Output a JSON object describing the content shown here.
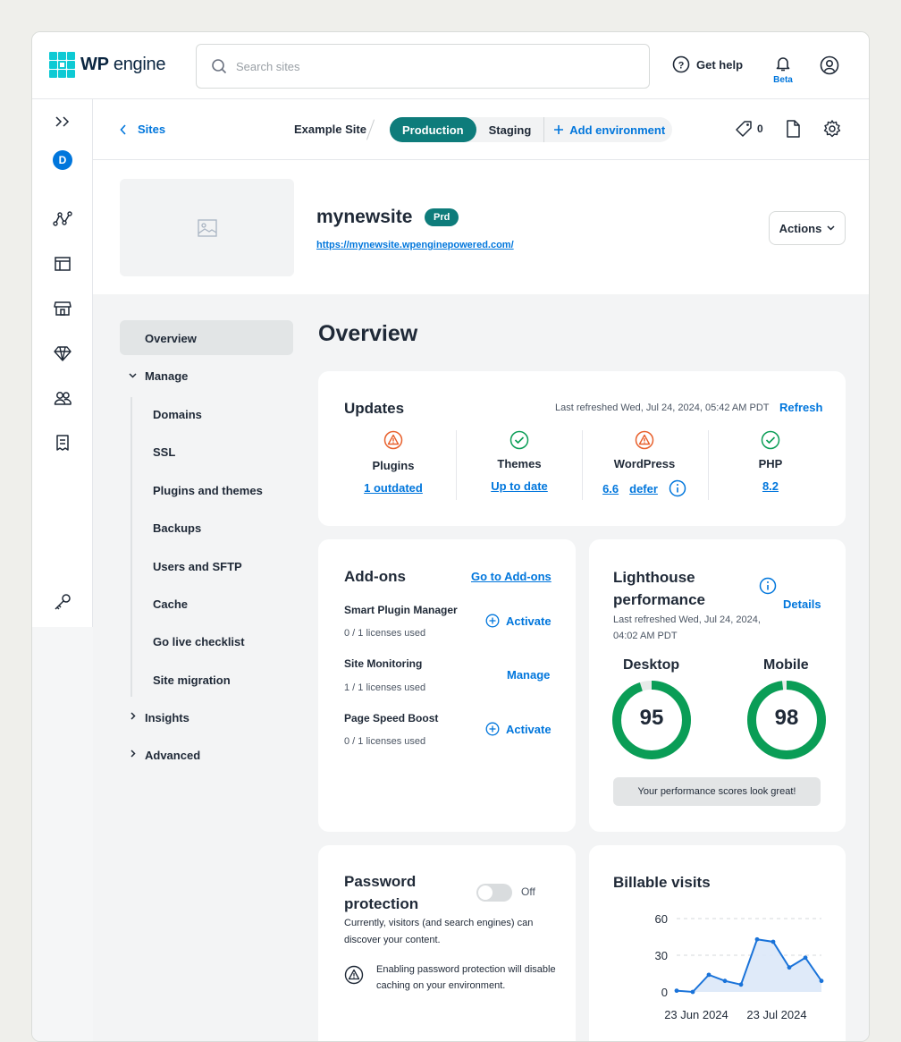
{
  "topbar": {
    "logo_text_bold": "WP",
    "logo_text": "engine",
    "search_placeholder": "Search sites",
    "help_label": "Get help",
    "beta_label": "Beta"
  },
  "rail": {
    "avatar_letter": "D"
  },
  "subbar": {
    "back_label": "Sites",
    "site_name": "Example Site",
    "env_production": "Production",
    "env_staging": "Staging",
    "add_env": "Add environment",
    "tag_count": "0"
  },
  "site": {
    "name": "mynewsite",
    "badge": "Prd",
    "url": "https://mynewsite.wpenginepowered.com/",
    "actions_label": "Actions"
  },
  "sidenav": {
    "overview": "Overview",
    "manage": "Manage",
    "items": [
      "Domains",
      "SSL",
      "Plugins and themes",
      "Backups",
      "Users and SFTP",
      "Cache",
      "Go live checklist",
      "Site migration"
    ],
    "insights": "Insights",
    "advanced": "Advanced"
  },
  "page_title": "Overview",
  "updates": {
    "title": "Updates",
    "refreshed": "Last refreshed Wed, Jul 24, 2024, 05:42 AM PDT",
    "refresh_label": "Refresh",
    "plugins_label": "Plugins",
    "plugins_status": "1 outdated",
    "themes_label": "Themes",
    "themes_status": "Up to date",
    "wp_label": "WordPress",
    "wp_version": "6.6",
    "wp_defer": "defer",
    "php_label": "PHP",
    "php_version": "8.2",
    "warn_color": "#e8602c",
    "ok_color": "#0a9d56"
  },
  "addons": {
    "title": "Add-ons",
    "go_label": "Go to Add-ons",
    "items": [
      {
        "name": "Smart Plugin Manager",
        "licenses": "0 / 1 licenses used",
        "action": "Activate"
      },
      {
        "name": "Site Monitoring",
        "licenses": "1 / 1 licenses used",
        "action": "Manage"
      },
      {
        "name": "Page Speed Boost",
        "licenses": "0 / 1 licenses used",
        "action": "Activate"
      }
    ]
  },
  "lighthouse": {
    "title": "Lighthouse performance",
    "details_label": "Details",
    "refreshed": "Last refreshed Wed, Jul 24, 2024, 04:02 AM PDT",
    "desktop_label": "Desktop",
    "desktop_score": "95",
    "mobile_label": "Mobile",
    "mobile_score": "98",
    "message": "Your performance scores look great!",
    "gauge_color": "#0a9d56"
  },
  "password": {
    "title": "Password protection",
    "toggle_label": "Off",
    "description": "Currently, visitors (and search engines) can discover your content.",
    "warning": "Enabling password protection will disable caching on your environment."
  },
  "billable": {
    "title": "Billable visits"
  },
  "chart_data": {
    "type": "area",
    "title": "Billable visits",
    "x_tick_labels": [
      "23 Jun 2024",
      "23 Jul 2024"
    ],
    "y_ticks": [
      0,
      30,
      60
    ],
    "ylim": [
      0,
      60
    ],
    "values": [
      1,
      0,
      14,
      9,
      6,
      43,
      41,
      20,
      28,
      9
    ],
    "color": "#1a73d9"
  }
}
